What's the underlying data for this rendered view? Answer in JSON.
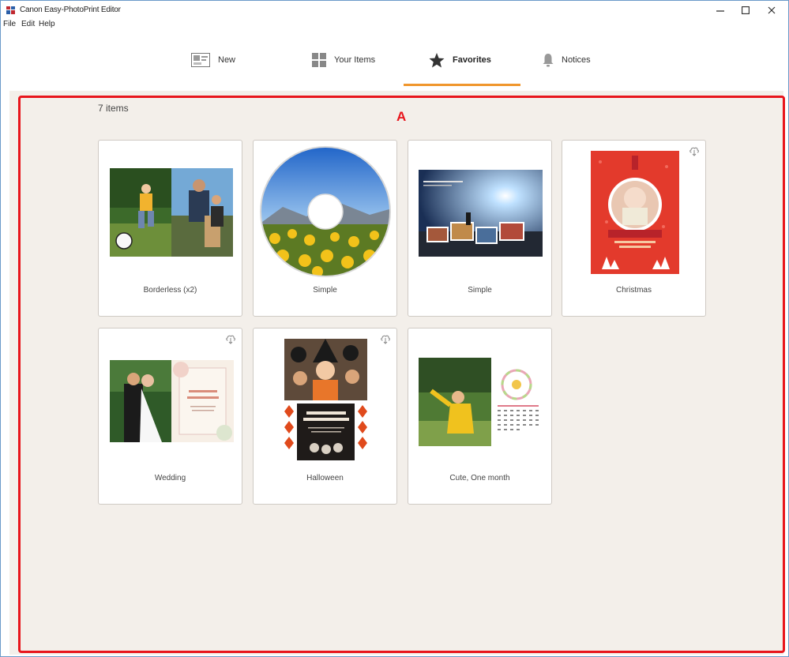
{
  "window": {
    "title": "Canon Easy-PhotoPrint Editor"
  },
  "menu": [
    "File",
    "Edit",
    "Help"
  ],
  "tabs": [
    {
      "label": "New",
      "icon": "new-icon"
    },
    {
      "label": "Your Items",
      "icon": "grid-icon"
    },
    {
      "label": "Favorites",
      "icon": "star-icon",
      "active": true
    },
    {
      "label": "Notices",
      "icon": "bell-icon"
    }
  ],
  "content": {
    "count": "7 items"
  },
  "annotation": {
    "label": "A",
    "color": "#e8151c"
  },
  "accent_color": "#f0962d",
  "cards": [
    {
      "label": "Borderless (x2)",
      "cloud": false
    },
    {
      "label": "Simple",
      "cloud": false
    },
    {
      "label": "Simple",
      "cloud": false
    },
    {
      "label": "Christmas",
      "cloud": true
    },
    {
      "label": "Wedding",
      "cloud": true
    },
    {
      "label": "Halloween",
      "cloud": true
    },
    {
      "label": "Cute, One month",
      "cloud": false
    }
  ],
  "halloween_text": "HAPPY\nHALLOWEEN",
  "wedding_text": "JUST\nMARRIED"
}
